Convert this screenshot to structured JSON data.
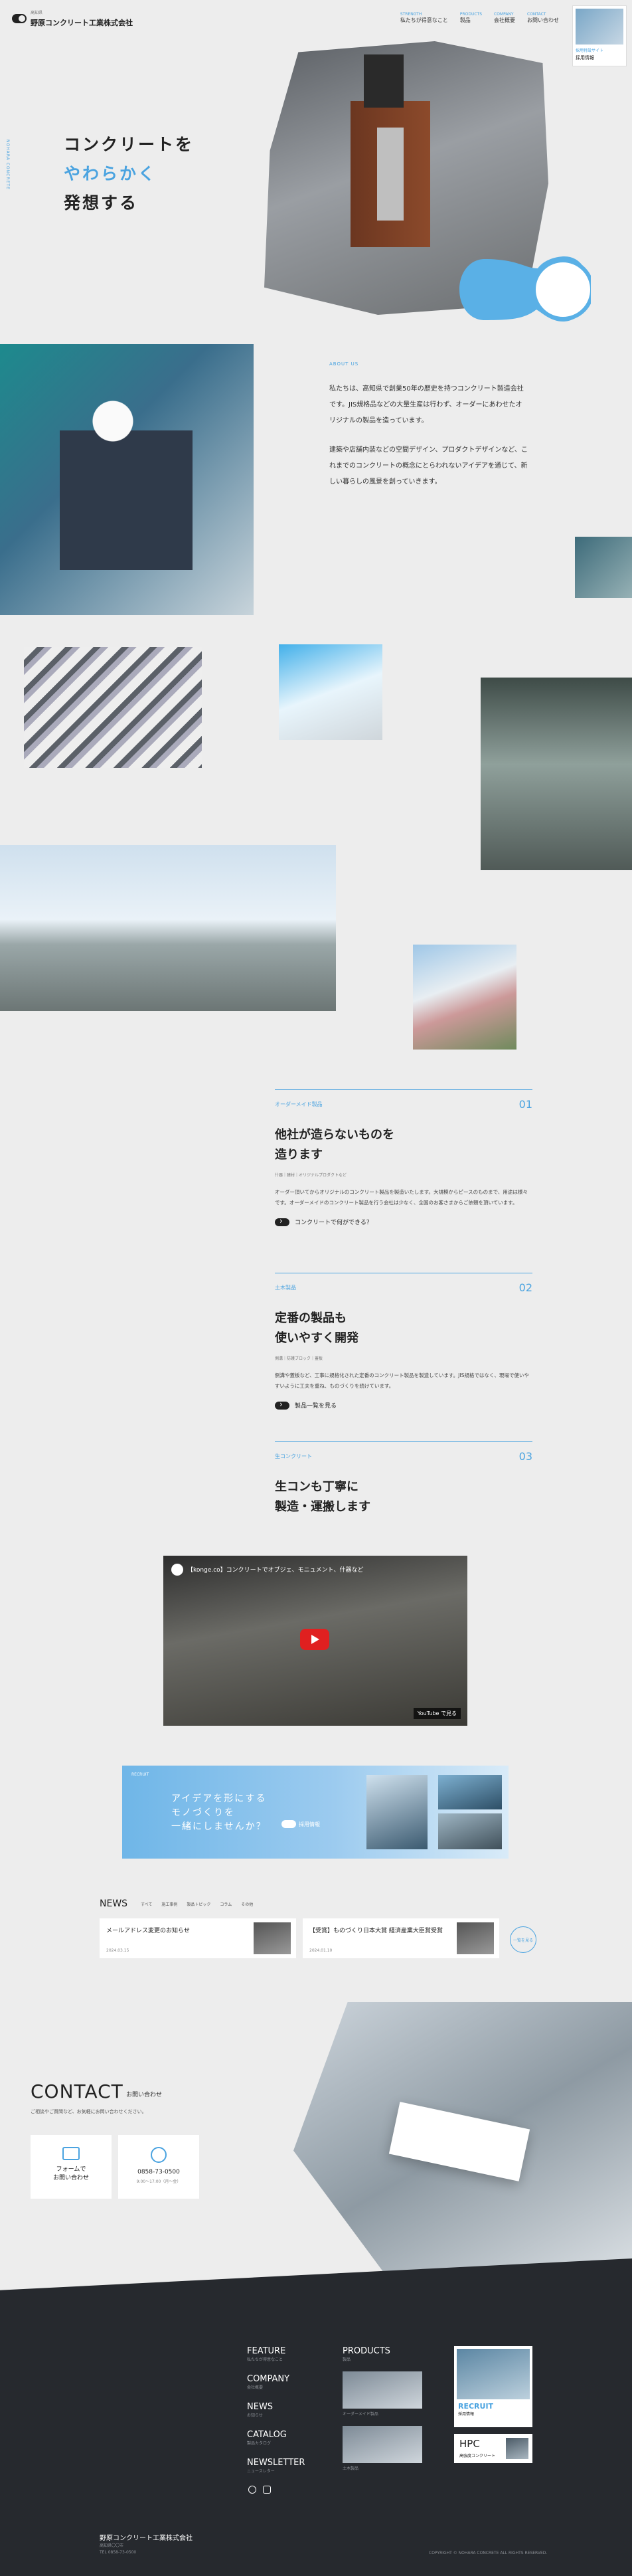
{
  "header": {
    "company_small": "高知県",
    "company": "野原コンクリート工業株式会社",
    "nav": [
      {
        "label": "私たちが得意なこと",
        "sub": "STRENGTH"
      },
      {
        "label": "製品",
        "sub": "PRODUCTS"
      },
      {
        "label": "会社概要",
        "sub": "COMPANY"
      },
      {
        "label": "お問い合わせ",
        "sub": "CONTACT"
      }
    ],
    "recruit_tile": {
      "label": "採用特設サイト",
      "title": "採用情報"
    }
  },
  "hero": {
    "vertical": "NOHARA CONCRETE",
    "line1": "コンクリートを",
    "line2": "やわらかく",
    "line3": "発想する"
  },
  "about": {
    "label": "ABOUT US",
    "p1": "私たちは、高知県で創業50年の歴史を持つコンクリート製造会社です。JIS規格品などの大量生産は行わず、オーダーにあわせたオリジナルの製品を造っています。",
    "p2": "建築や店舗内装などの空間デザイン、プロダクトデザインなど、これまでのコンクリートの概念にとらわれないアイデアを通じて、新しい暮らしの風景を創っていきます。"
  },
  "features": [
    {
      "cat": "オーダーメイド製品",
      "num": "01",
      "title1": "他社が造らないものを",
      "title2": "造ります",
      "tags": "什器｜建材｜オリジナルプロダクトなど",
      "desc": "オーダー頂いてからオリジナルのコンクリート製品を製造いたします。大規模からピースのものまで、用途は様々です。オーダーメイドのコンクリート製品を行う会社は少なく、全国のお客さまからご依頼を頂いています。",
      "more": "コンクリートで何ができる？"
    },
    {
      "cat": "土木製品",
      "num": "02",
      "title1": "定番の製品も",
      "title2": "使いやすく開発",
      "tags": "側溝｜防護ブロック｜蓋板",
      "desc": "側溝や蓋板など、工事に規格化された定番のコンクリート製品を製造しています。JIS規格ではなく、現場で使いやすいように工夫を重ね、ものづくりを続けています。",
      "more": "製品一覧を見る"
    },
    {
      "cat": "生コンクリート",
      "num": "03",
      "title1": "生コンも丁寧に",
      "title2": "製造・運搬します"
    }
  ],
  "video": {
    "title": "【konge.co】コンクリートでオブジェ、モニュメント、什器など",
    "watch": "YouTube で見る"
  },
  "banner": {
    "label": "RECRUIT",
    "copy1": "アイデアを形にする",
    "copy2": "モノづくりを",
    "copy3": "一緒にしませんか？",
    "btn": "採用情報"
  },
  "news": {
    "title": "NEWS",
    "tabs": [
      "すべて",
      "施工事例",
      "製品トピック",
      "コラム",
      "その他"
    ],
    "items": [
      {
        "title": "メールアドレス変更のお知らせ",
        "date": "2024.03.15"
      },
      {
        "title": "【受賞】ものづくり日本大賞 経済産業大臣賞受賞",
        "date": "2024.01.10"
      }
    ],
    "more": "一覧を見る"
  },
  "contact": {
    "title": "CONTACT",
    "sub": "お問い合わせ",
    "note": "ご相談やご質問など、お気軽にお問い合わせください。",
    "form1": "フォームで",
    "form2": "お問い合わせ",
    "tel": "0858-73-0500",
    "hours": "9:00〜17:00（月〜金）"
  },
  "footer": {
    "nav": [
      {
        "label": "FEATURE",
        "sub": "私たちが得意なこと"
      },
      {
        "label": "COMPANY",
        "sub": "会社概要"
      },
      {
        "label": "NEWS",
        "sub": "お知らせ"
      },
      {
        "label": "CATALOG",
        "sub": "製品カタログ"
      },
      {
        "label": "NEWSLETTER",
        "sub": "ニュースレター"
      }
    ],
    "products": {
      "label": "PRODUCTS",
      "sub": "製品",
      "items": [
        "オーダーメイド製品",
        "土木製品"
      ]
    },
    "recruit": {
      "label": "RECRUIT",
      "sub": "採用情報"
    },
    "hpc": {
      "label": "HPC",
      "sub": "高強度コンクリート"
    },
    "company": "野原コンクリート工業株式会社",
    "addr1": "高知県〇〇市",
    "addr2": "TEL 0858-73-0500",
    "copyright": "COPYRIGHT © NOHARA CONCRETE ALL RIGHTS RESERVED."
  }
}
